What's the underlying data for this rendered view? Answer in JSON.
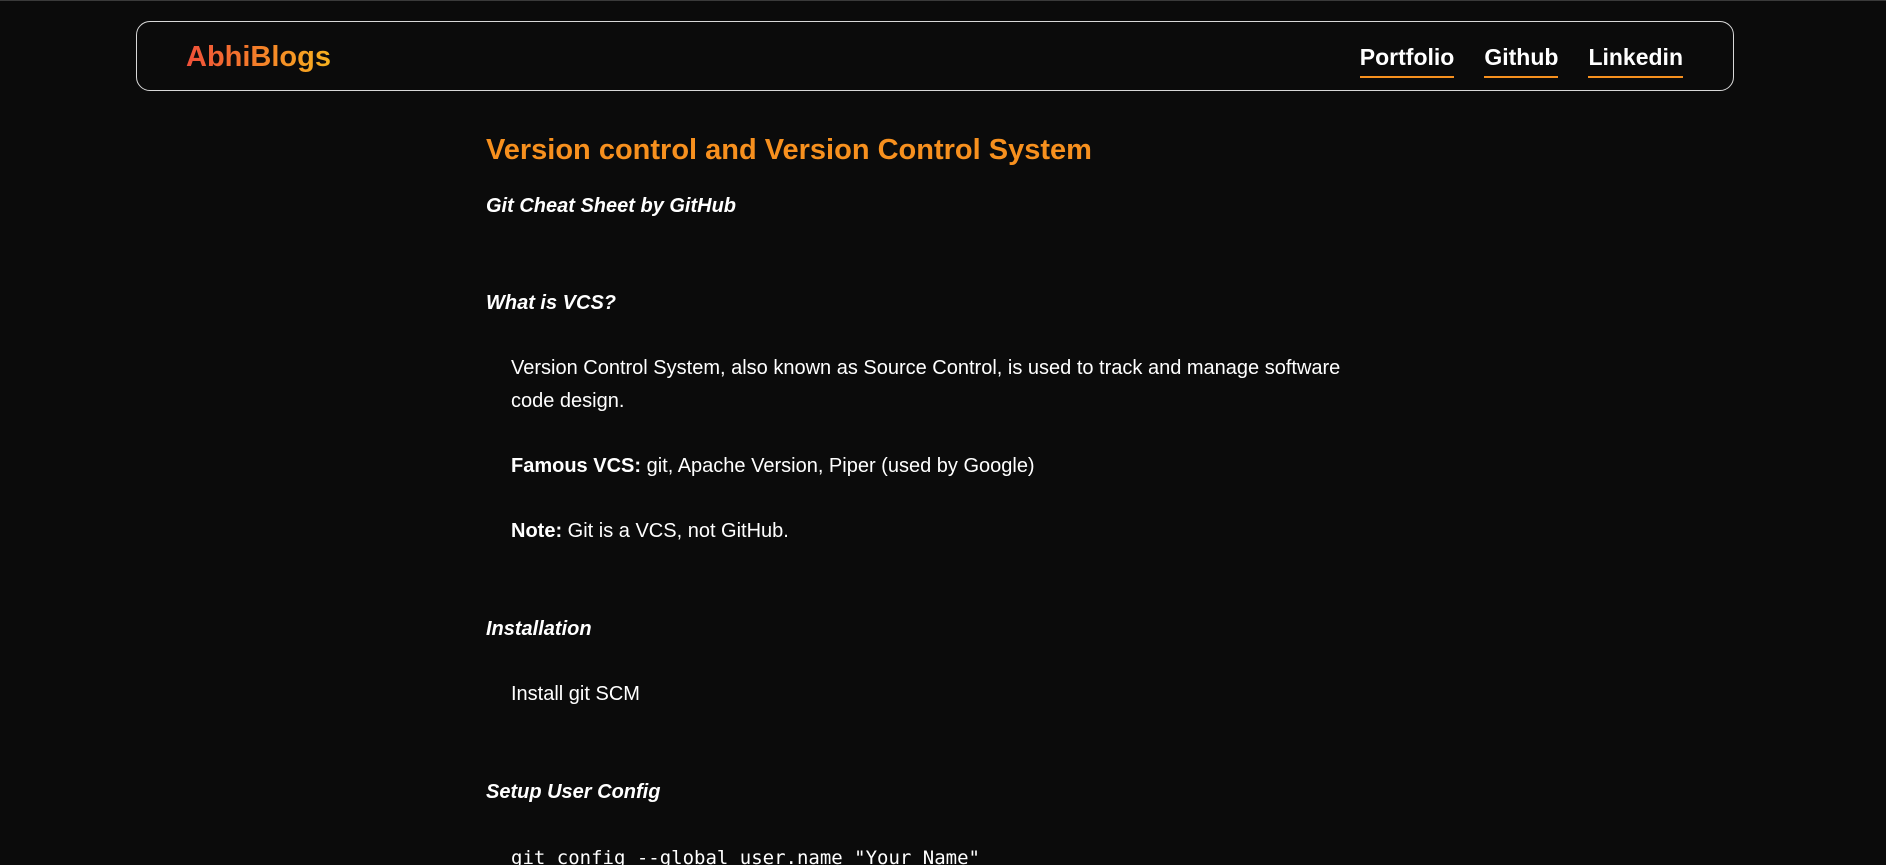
{
  "header": {
    "logo": "AbhiBlogs",
    "nav": [
      "Portfolio",
      "Github",
      "Linkedin"
    ]
  },
  "article": {
    "title": "Version control and Version Control System",
    "subtitle": "Git Cheat Sheet by GitHub",
    "sections": [
      {
        "heading": "What is VCS?",
        "paragraphs": [
          "Version Control System, also known as Source Control, is used to track and manage software code design."
        ],
        "famous_label": "Famous VCS:",
        "famous_text": " git, Apache Version, Piper (used by Google)",
        "note_label": "Note:",
        "note_text": " Git is a VCS, not GitHub."
      },
      {
        "heading": "Installation",
        "text": "Install git SCM"
      },
      {
        "heading": "Setup User Config",
        "code": "git config --global user.name \"Your Name\""
      }
    ]
  },
  "colors": {
    "accent": "#f7901e",
    "background": "#0b0b0b",
    "logo_gradient": [
      "#f0503a",
      "#f7b21f"
    ]
  }
}
